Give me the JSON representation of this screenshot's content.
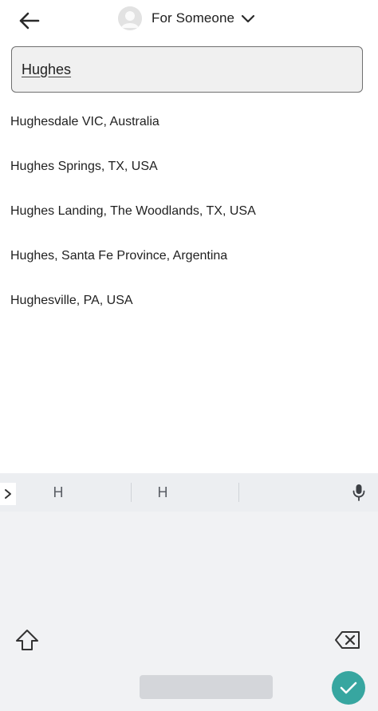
{
  "header": {
    "title": "For Someone",
    "back_icon": "arrow-left-icon",
    "avatar_icon": "person-avatar-icon",
    "chevron_icon": "chevron-down-icon"
  },
  "search": {
    "value": "Hughes",
    "placeholder": ""
  },
  "suggestions": [
    {
      "label": "Hughesdale VIC, Australia"
    },
    {
      "label": "Hughes Springs, TX, USA"
    },
    {
      "label": "Hughes Landing, The Woodlands, TX, USA"
    },
    {
      "label": "Hughes, Santa Fe Province, Argentina"
    },
    {
      "label": "Hughesville, PA, USA"
    }
  ],
  "keyboard": {
    "suggestions": [
      "H",
      "H"
    ],
    "expand_icon": "chevron-right-icon",
    "mic_icon": "microphone-icon",
    "shift_icon": "shift-icon",
    "backspace_icon": "backspace-icon",
    "done_icon": "check-icon",
    "accent_color": "#37a6a0"
  }
}
